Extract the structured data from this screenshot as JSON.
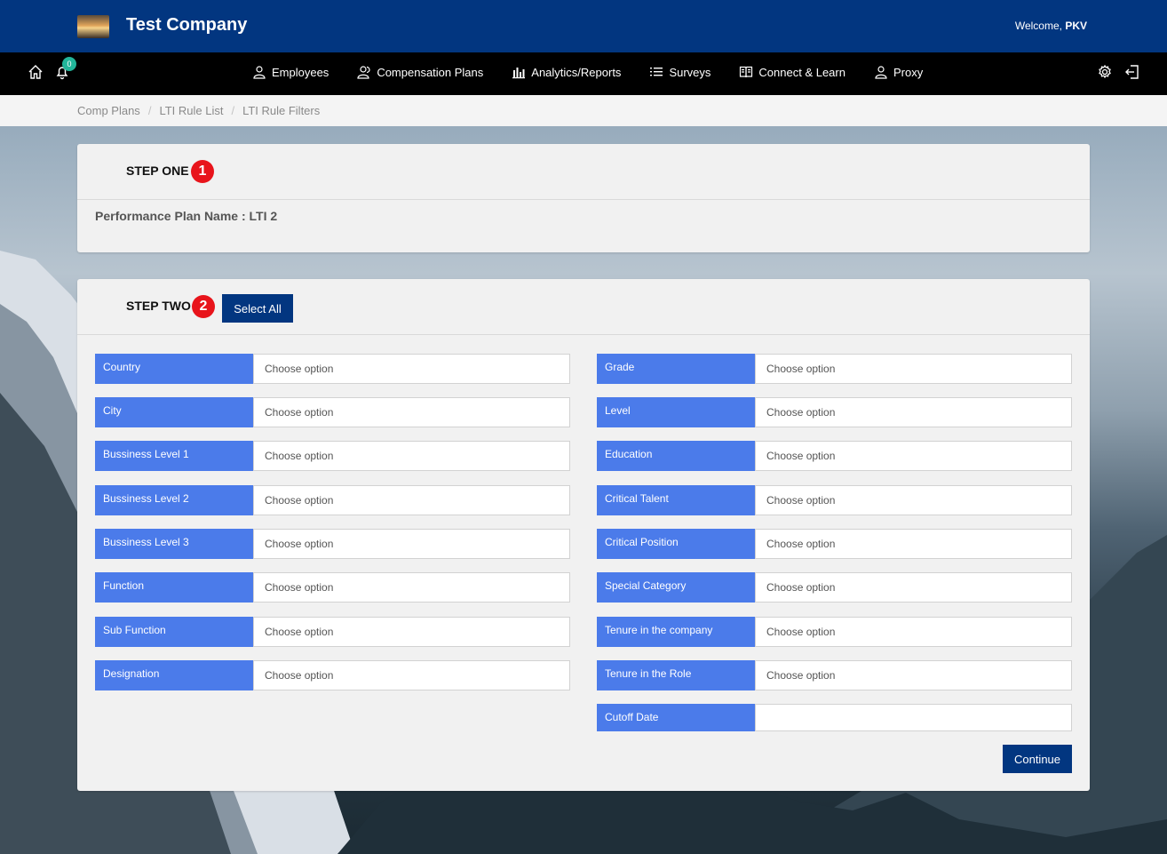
{
  "header": {
    "company": "Test Company",
    "welcome_prefix": "Welcome, ",
    "user": "PKV"
  },
  "nav": {
    "notification_count": "0",
    "items": [
      {
        "label": "Employees",
        "icon": "user-icon"
      },
      {
        "label": "Compensation Plans",
        "icon": "users-icon"
      },
      {
        "label": "Analytics/Reports",
        "icon": "bar-chart-icon"
      },
      {
        "label": "Surveys",
        "icon": "list-icon"
      },
      {
        "label": "Connect & Learn",
        "icon": "book-icon"
      },
      {
        "label": "Proxy",
        "icon": "user-icon"
      }
    ]
  },
  "breadcrumb": [
    "Comp Plans",
    "LTI Rule List",
    "LTI Rule Filters"
  ],
  "step_one": {
    "title": "STEP ONE",
    "number": "1",
    "plan_name": "Performance Plan Name : LTI 2"
  },
  "step_two": {
    "title": "STEP TWO",
    "number": "2",
    "select_all": "Select All",
    "continue": "Continue",
    "placeholder": "Choose option",
    "left_fields": [
      "Country",
      "City",
      "Bussiness Level 1",
      "Bussiness Level 2",
      "Bussiness Level 3",
      "Function",
      "Sub Function",
      "Designation"
    ],
    "right_fields": [
      "Grade",
      "Level",
      "Education",
      "Critical Talent",
      "Critical Position",
      "Special Category",
      "Tenure in the company",
      "Tenure in the Role"
    ],
    "cutoff_label": "Cutoff Date",
    "cutoff_value": ""
  }
}
